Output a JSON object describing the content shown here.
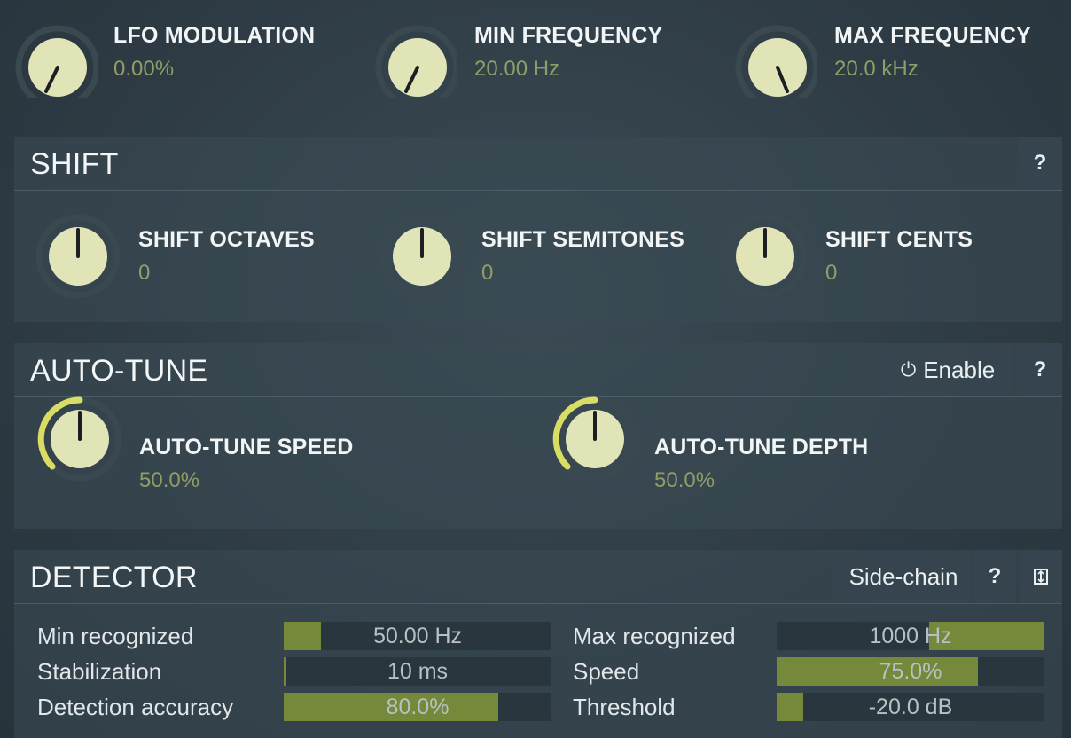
{
  "top_knobs": [
    {
      "title": "LFO MODULATION",
      "value": "0.00%"
    },
    {
      "title": "MIN FREQUENCY",
      "value": "20.00 Hz"
    },
    {
      "title": "MAX FREQUENCY",
      "value": "20.0 kHz"
    }
  ],
  "shift": {
    "title": "SHIFT",
    "help": "?",
    "knobs": [
      {
        "title": "SHIFT OCTAVES",
        "value": "0"
      },
      {
        "title": "SHIFT SEMITONES",
        "value": "0"
      },
      {
        "title": "SHIFT CENTS",
        "value": "0"
      }
    ]
  },
  "autotune": {
    "title": "AUTO-TUNE",
    "enable_label": "Enable",
    "help": "?",
    "knobs": [
      {
        "title": "AUTO-TUNE SPEED",
        "value": "50.0%"
      },
      {
        "title": "AUTO-TUNE DEPTH",
        "value": "50.0%"
      }
    ]
  },
  "detector": {
    "title": "DETECTOR",
    "sidechain_label": "Side-chain",
    "help": "?",
    "rows": [
      {
        "label": "Min recognized",
        "value": "50.00 Hz",
        "fill": 0.14
      },
      {
        "label": "Max recognized",
        "value": "1000 Hz",
        "fill": 0.43
      },
      {
        "label": "Stabilization",
        "value": "10 ms",
        "fill": 0.01
      },
      {
        "label": "Speed",
        "value": "75.0%",
        "fill": 0.75
      },
      {
        "label": "Detection accuracy",
        "value": "80.0%",
        "fill": 0.8
      },
      {
        "label": "Threshold",
        "value": "-20.0 dB",
        "fill": 0.1
      }
    ]
  },
  "colors": {
    "accent": "#d9dd66",
    "value_text": "#8f9e66",
    "slider_fill": "#76883a"
  }
}
